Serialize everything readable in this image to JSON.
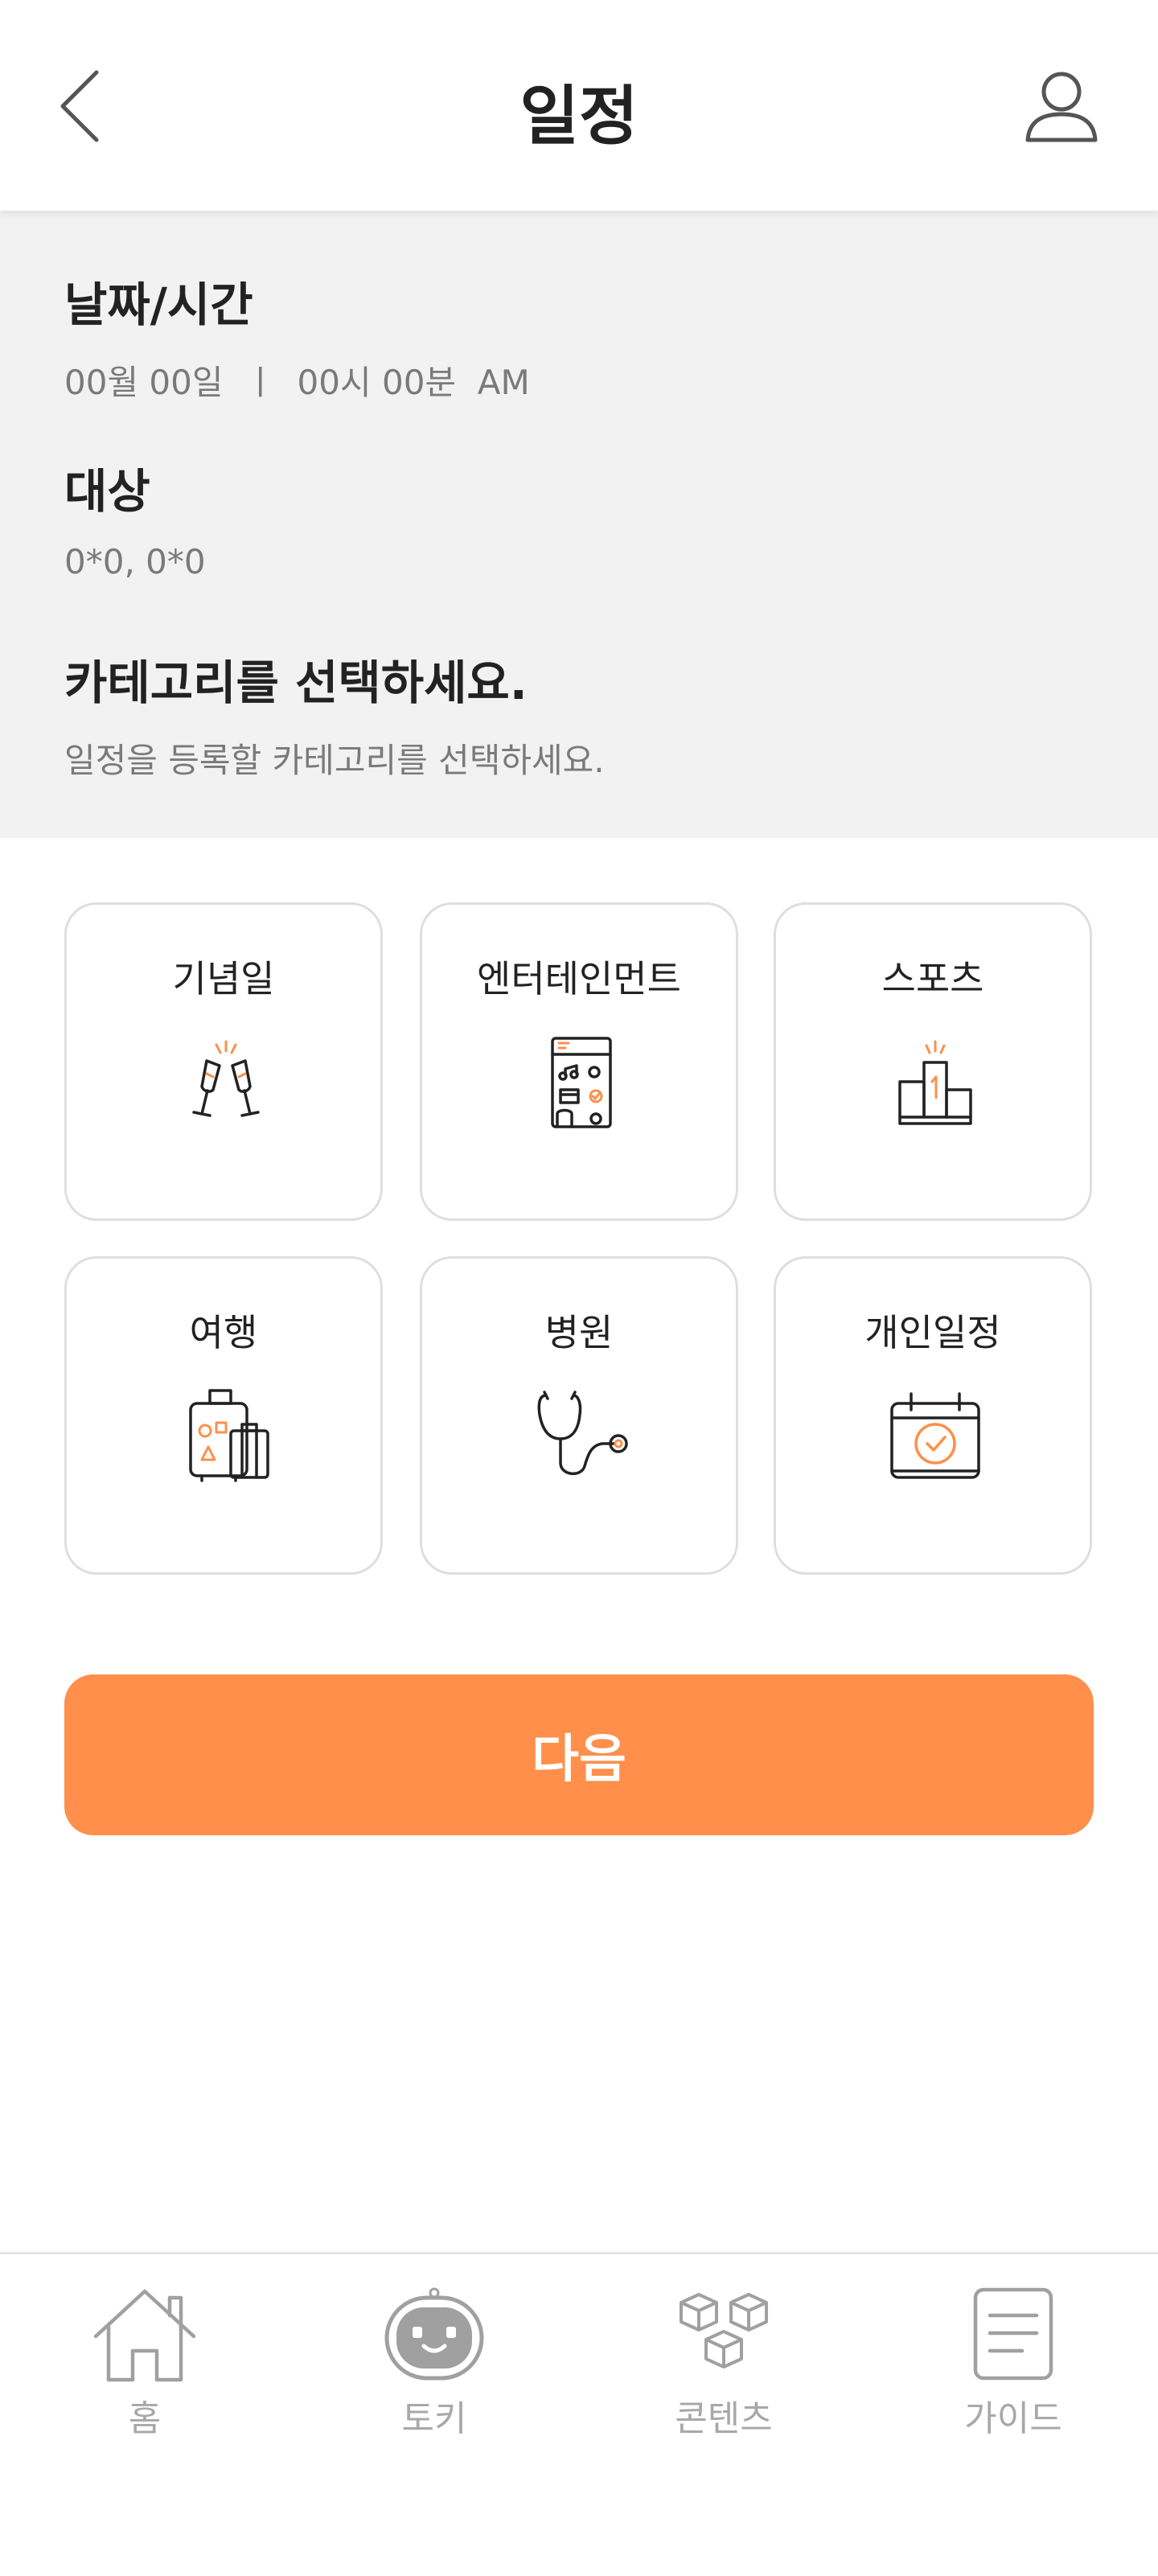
{
  "header": {
    "title": "일정"
  },
  "info": {
    "datetime_label": "날짜/시간",
    "datetime_value": "00월 00일  ㅣ  00시 00분  AM",
    "target_label": "대상",
    "target_value": "0*0, 0*0",
    "category_label": "카테고리를 선택하세요.",
    "category_hint": "일정을 등록할 카테고리를 선택하세요."
  },
  "categories": [
    {
      "label": "기념일",
      "icon": "champagne-toast-icon"
    },
    {
      "label": "엔터테인먼트",
      "icon": "entertainment-icon"
    },
    {
      "label": "스포츠",
      "icon": "podium-icon"
    },
    {
      "label": "여행",
      "icon": "luggage-icon"
    },
    {
      "label": "병원",
      "icon": "stethoscope-icon"
    },
    {
      "label": "개인일정",
      "icon": "calendar-check-icon"
    }
  ],
  "next_button": {
    "label": "다음"
  },
  "bottom_nav": [
    {
      "label": "홈",
      "icon": "home-icon"
    },
    {
      "label": "토키",
      "icon": "robot-icon"
    },
    {
      "label": "콘텐츠",
      "icon": "cubes-icon"
    },
    {
      "label": "가이드",
      "icon": "document-icon"
    }
  ],
  "colors": {
    "accent": "#ff8f4b",
    "panel_bg": "#f2f2f2",
    "muted_text": "#7a7a7a",
    "nav_text": "#a8a8a8"
  }
}
